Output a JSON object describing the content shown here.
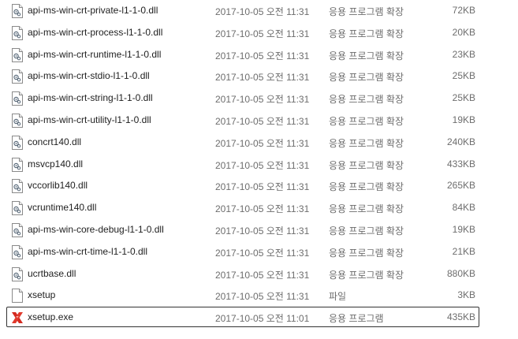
{
  "files": [
    {
      "name": "api-ms-win-crt-private-l1-1-0.dll",
      "date": "2017-10-05 오전 11:31",
      "type": "응용 프로그램 확장",
      "size": "72KB",
      "icon": "dll-file-icon",
      "selected": false
    },
    {
      "name": "api-ms-win-crt-process-l1-1-0.dll",
      "date": "2017-10-05 오전 11:31",
      "type": "응용 프로그램 확장",
      "size": "20KB",
      "icon": "dll-file-icon",
      "selected": false
    },
    {
      "name": "api-ms-win-crt-runtime-l1-1-0.dll",
      "date": "2017-10-05 오전 11:31",
      "type": "응용 프로그램 확장",
      "size": "23KB",
      "icon": "dll-file-icon",
      "selected": false
    },
    {
      "name": "api-ms-win-crt-stdio-l1-1-0.dll",
      "date": "2017-10-05 오전 11:31",
      "type": "응용 프로그램 확장",
      "size": "25KB",
      "icon": "dll-file-icon",
      "selected": false
    },
    {
      "name": "api-ms-win-crt-string-l1-1-0.dll",
      "date": "2017-10-05 오전 11:31",
      "type": "응용 프로그램 확장",
      "size": "25KB",
      "icon": "dll-file-icon",
      "selected": false
    },
    {
      "name": "api-ms-win-crt-utility-l1-1-0.dll",
      "date": "2017-10-05 오전 11:31",
      "type": "응용 프로그램 확장",
      "size": "19KB",
      "icon": "dll-file-icon",
      "selected": false
    },
    {
      "name": "concrt140.dll",
      "date": "2017-10-05 오전 11:31",
      "type": "응용 프로그램 확장",
      "size": "240KB",
      "icon": "dll-file-icon",
      "selected": false
    },
    {
      "name": "msvcp140.dll",
      "date": "2017-10-05 오전 11:31",
      "type": "응용 프로그램 확장",
      "size": "433KB",
      "icon": "dll-file-icon",
      "selected": false
    },
    {
      "name": "vccorlib140.dll",
      "date": "2017-10-05 오전 11:31",
      "type": "응용 프로그램 확장",
      "size": "265KB",
      "icon": "dll-file-icon",
      "selected": false
    },
    {
      "name": "vcruntime140.dll",
      "date": "2017-10-05 오전 11:31",
      "type": "응용 프로그램 확장",
      "size": "84KB",
      "icon": "dll-file-icon",
      "selected": false
    },
    {
      "name": "api-ms-win-core-debug-l1-1-0.dll",
      "date": "2017-10-05 오전 11:31",
      "type": "응용 프로그램 확장",
      "size": "19KB",
      "icon": "dll-file-icon",
      "selected": false
    },
    {
      "name": "api-ms-win-crt-time-l1-1-0.dll",
      "date": "2017-10-05 오전 11:31",
      "type": "응용 프로그램 확장",
      "size": "21KB",
      "icon": "dll-file-icon",
      "selected": false
    },
    {
      "name": "ucrtbase.dll",
      "date": "2017-10-05 오전 11:31",
      "type": "응용 프로그램 확장",
      "size": "880KB",
      "icon": "dll-file-icon",
      "selected": false
    },
    {
      "name": "xsetup",
      "date": "2017-10-05 오전 11:31",
      "type": "파일",
      "size": "3KB",
      "icon": "blank-file-icon",
      "selected": false
    },
    {
      "name": "xsetup.exe",
      "date": "2017-10-05 오전 11:01",
      "type": "응용 프로그램",
      "size": "435KB",
      "icon": "xilinx-app-icon",
      "selected": true
    }
  ]
}
